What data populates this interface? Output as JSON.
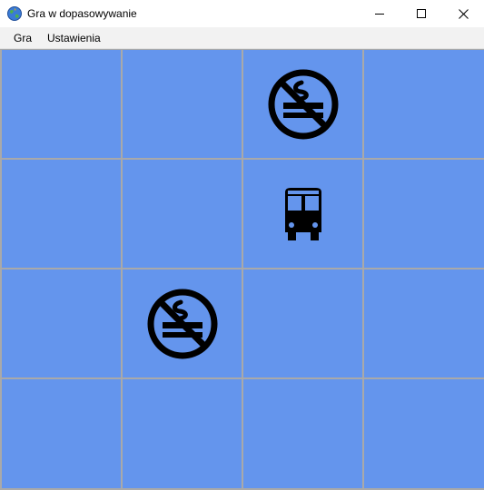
{
  "window": {
    "title": "Gra w dopasowywanie",
    "app_icon": "globe-app-icon",
    "controls": [
      "minimize-icon",
      "maximize-icon",
      "close-icon"
    ]
  },
  "menu": {
    "items": [
      "Gra",
      "Ustawienia"
    ]
  },
  "board": {
    "rows": 4,
    "columns": 4,
    "tile_color": "#6495ed",
    "grid_line_color": "#a9a9a9",
    "tiles": [
      [
        "",
        "",
        "no-smoking-icon",
        ""
      ],
      [
        "",
        "",
        "bus-icon",
        ""
      ],
      [
        "",
        "no-smoking-icon",
        "",
        ""
      ],
      [
        "",
        "",
        "",
        ""
      ]
    ]
  }
}
